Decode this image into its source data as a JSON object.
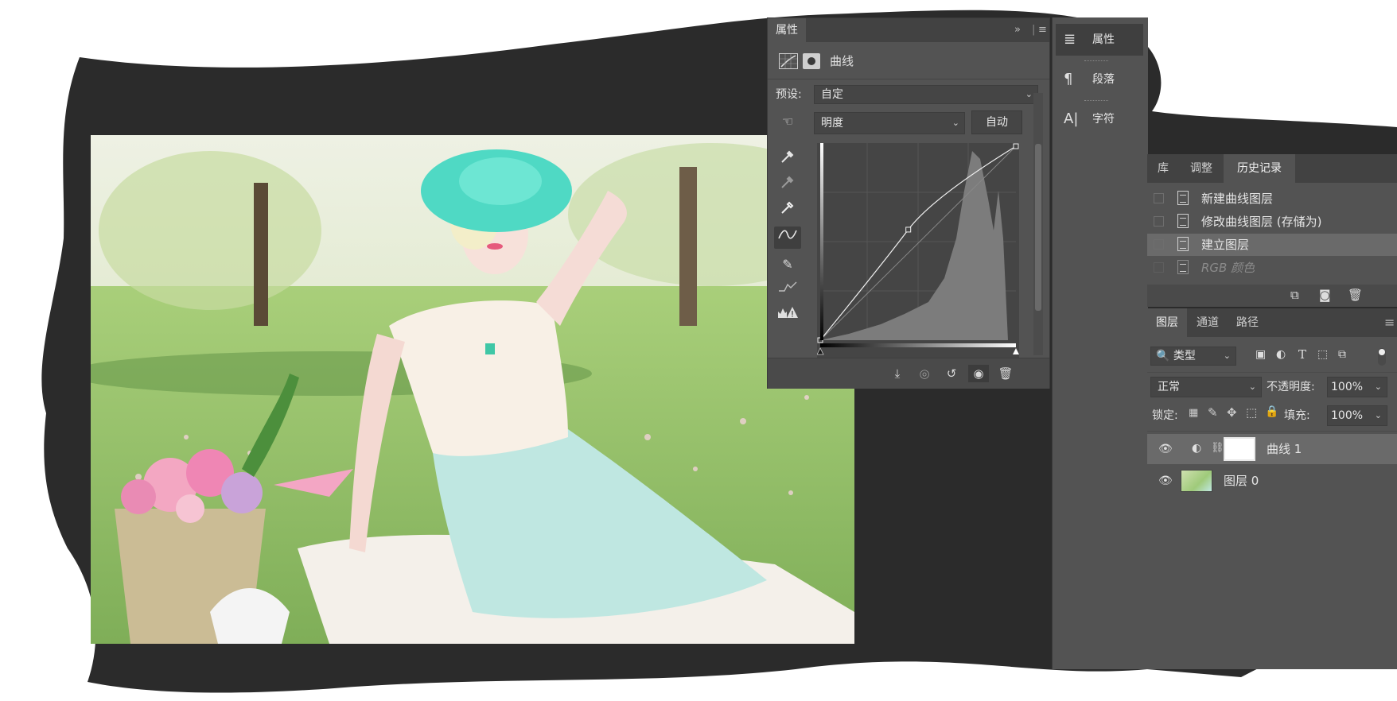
{
  "colors": {
    "canvas_bg": "#2b2b2b",
    "panel_bg": "#535353",
    "panel_dark": "#424242"
  },
  "properties_panel": {
    "tab": "属性",
    "adjust_title": "曲线",
    "preset_label": "预设:",
    "preset_value": "自定",
    "channel_value": "明度",
    "auto_button": "自动",
    "curve_points": [
      [
        0,
        0
      ],
      [
        0.45,
        0.57
      ],
      [
        1,
        1
      ]
    ]
  },
  "side_panel": {
    "items": [
      {
        "label": "属性",
        "icon": "sliders-icon"
      },
      {
        "label": "段落",
        "icon": "pilcrow-icon"
      },
      {
        "label": "字符",
        "icon": "character-icon"
      }
    ]
  },
  "history_panel": {
    "tabs": [
      "库",
      "调整",
      "历史记录"
    ],
    "items": [
      "新建曲线图层",
      "修改曲线图层 (存储为)",
      "建立图层",
      "RGB 颜色"
    ]
  },
  "layers_panel": {
    "tabs": [
      "图层",
      "通道",
      "路径"
    ],
    "filter_label": "类型",
    "blend_mode": "正常",
    "opacity_label": "不透明度:",
    "opacity_value": "100%",
    "lock_label": "锁定:",
    "fill_label": "填充:",
    "fill_value": "100%",
    "layers": [
      {
        "name": "曲线 1"
      },
      {
        "name": "图层 0"
      }
    ]
  }
}
